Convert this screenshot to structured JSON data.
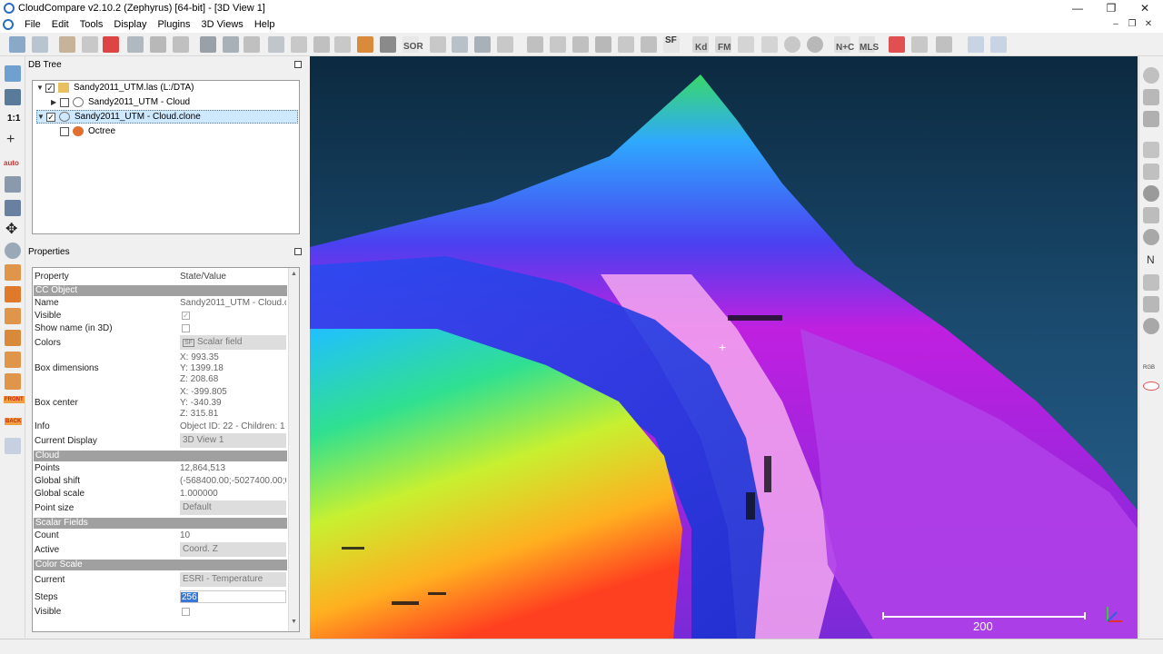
{
  "window": {
    "title": "CloudCompare v2.10.2 (Zephyrus) [64-bit] - [3D View 1]"
  },
  "menu": [
    "File",
    "Edit",
    "Tools",
    "Display",
    "Plugins",
    "3D Views",
    "Help"
  ],
  "toolbar": {
    "labels": {
      "sor": "SOR",
      "sf": "SF",
      "kd": "Kd",
      "fm": "FM",
      "nc": "N+C",
      "mls": "MLS"
    }
  },
  "left_toolbar": {
    "scale_label": "1:1",
    "auto_label": "auto",
    "front_label": "FRONT",
    "back_label": "BACK"
  },
  "right_toolbar": {
    "n_label": "N",
    "rgb_label": "RGB"
  },
  "db_tree": {
    "title": "DB Tree",
    "rows": [
      {
        "label": "Sandy2011_UTM.las (L:/DTA)"
      },
      {
        "label": "Sandy2011_UTM - Cloud"
      },
      {
        "label": "Sandy2011_UTM - Cloud.clone"
      },
      {
        "label": "Octree"
      }
    ]
  },
  "properties": {
    "title": "Properties",
    "header": {
      "property": "Property",
      "value": "State/Value"
    },
    "sections": {
      "cc_object": "CC Object",
      "cloud": "Cloud",
      "scalar_fields": "Scalar Fields",
      "color_scale": "Color Scale"
    },
    "rows": {
      "name": {
        "k": "Name",
        "v": "Sandy2011_UTM - Cloud.clone"
      },
      "visible": {
        "k": "Visible",
        "v": "✓"
      },
      "show_name": {
        "k": "Show name (in 3D)"
      },
      "colors": {
        "k": "Colors",
        "v": "Scalar field"
      },
      "box_dim": {
        "k": "Box dimensions",
        "x": "X: 993.35",
        "y": "Y: 1399.18",
        "z": "Z: 208.68"
      },
      "box_center": {
        "k": "Box center",
        "x": "X: -399.805",
        "y": "Y: -340.39",
        "z": "Z: 315.81"
      },
      "info": {
        "k": "Info",
        "v": "Object ID: 22 - Children: 1"
      },
      "current_display": {
        "k": "Current Display",
        "v": "3D View 1"
      },
      "points": {
        "k": "Points",
        "v": "12,864,513"
      },
      "global_shift": {
        "k": "Global shift",
        "v": "(-568400.00;-5027400.00;0.00)"
      },
      "global_scale": {
        "k": "Global scale",
        "v": "1.000000"
      },
      "point_size": {
        "k": "Point size",
        "v": "Default"
      },
      "count": {
        "k": "Count",
        "v": "10"
      },
      "active": {
        "k": "Active",
        "v": "Coord. Z"
      },
      "current": {
        "k": "Current",
        "v": "ESRI - Temperature"
      },
      "steps": {
        "k": "Steps",
        "v": "256"
      },
      "visible2": {
        "k": "Visible"
      }
    }
  },
  "view3d": {
    "scale_label": "200"
  }
}
